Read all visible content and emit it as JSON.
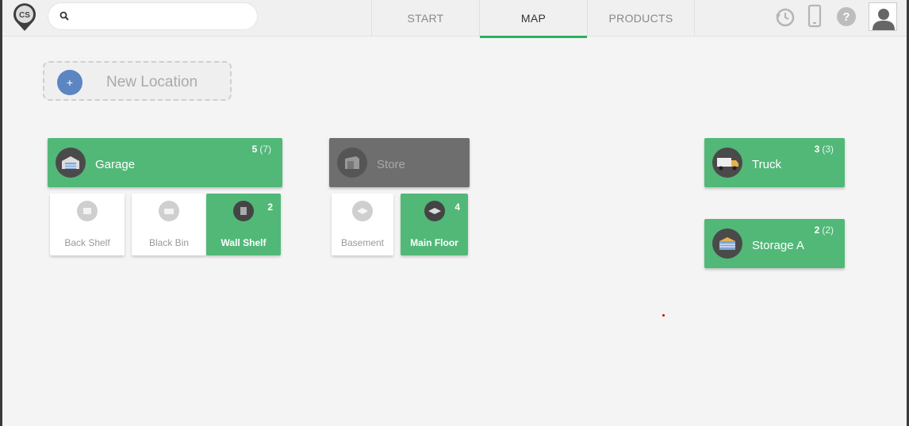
{
  "app": {
    "logo_text": "CS"
  },
  "search": {
    "value": "",
    "placeholder": ""
  },
  "tabs": [
    {
      "label": "START",
      "active": false
    },
    {
      "label": "MAP",
      "active": true
    },
    {
      "label": "PRODUCTS",
      "active": false
    }
  ],
  "toolbar_icons": [
    "history-icon",
    "phone-icon",
    "help-icon",
    "user-avatar"
  ],
  "new_location": {
    "plus": "+",
    "label": "New Location"
  },
  "locations": {
    "garage": {
      "name": "Garage",
      "count": "5",
      "total": "(7)",
      "children": {
        "back_shelf": {
          "name": "Back Shelf"
        },
        "black_bin": {
          "name": "Black Bin"
        },
        "wall_shelf": {
          "name": "Wall Shelf",
          "count": "2"
        }
      }
    },
    "store": {
      "name": "Store",
      "children": {
        "basement": {
          "name": "Basement"
        },
        "main_floor": {
          "name": "Main Floor",
          "count": "4"
        }
      }
    },
    "truck": {
      "name": "Truck",
      "count": "3",
      "total": "(3)"
    },
    "storage_a": {
      "name": "Storage A",
      "count": "2",
      "total": "(2)"
    }
  },
  "colors": {
    "accent": "#52b878",
    "inactive": "#6e6e6e",
    "tab_underline": "#27b35a",
    "plus_button": "#5b86c2"
  }
}
